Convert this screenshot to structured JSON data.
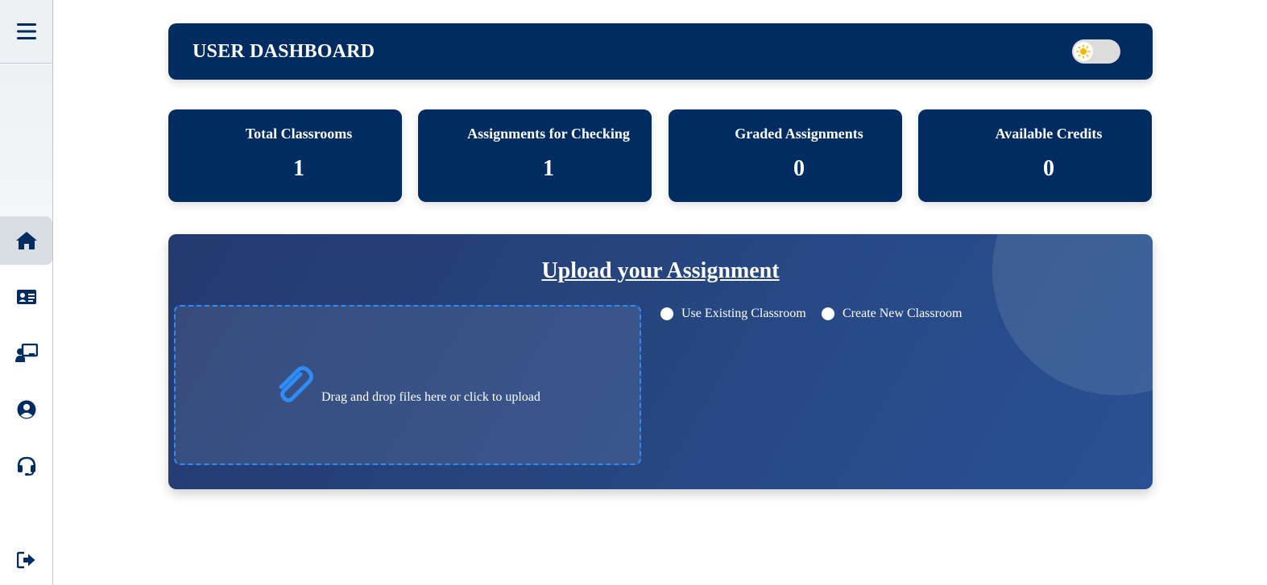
{
  "header": {
    "title": "USER DASHBOARD"
  },
  "stats": [
    {
      "label": "Total Classrooms",
      "value": "1"
    },
    {
      "label": "Assignments for Checking",
      "value": "1"
    },
    {
      "label": "Graded Assignments",
      "value": "0"
    },
    {
      "label": "Available Credits",
      "value": "0"
    }
  ],
  "upload": {
    "title": "Upload your Assignment",
    "drop_text": "Drag and drop files here or click to upload",
    "options": [
      {
        "label": "Use Existing Classroom"
      },
      {
        "label": "Create New Classroom"
      }
    ]
  },
  "sidebar": {
    "items": [
      {
        "icon": "home-icon",
        "active": true
      },
      {
        "icon": "id-card-icon"
      },
      {
        "icon": "chalkboard-teacher-icon"
      },
      {
        "icon": "user-circle-icon"
      },
      {
        "icon": "headset-icon"
      },
      {
        "icon": "logout-icon"
      }
    ]
  },
  "colors": {
    "primary": "#002c61",
    "accent": "#2f8cf5",
    "sun": "#f6b500"
  }
}
